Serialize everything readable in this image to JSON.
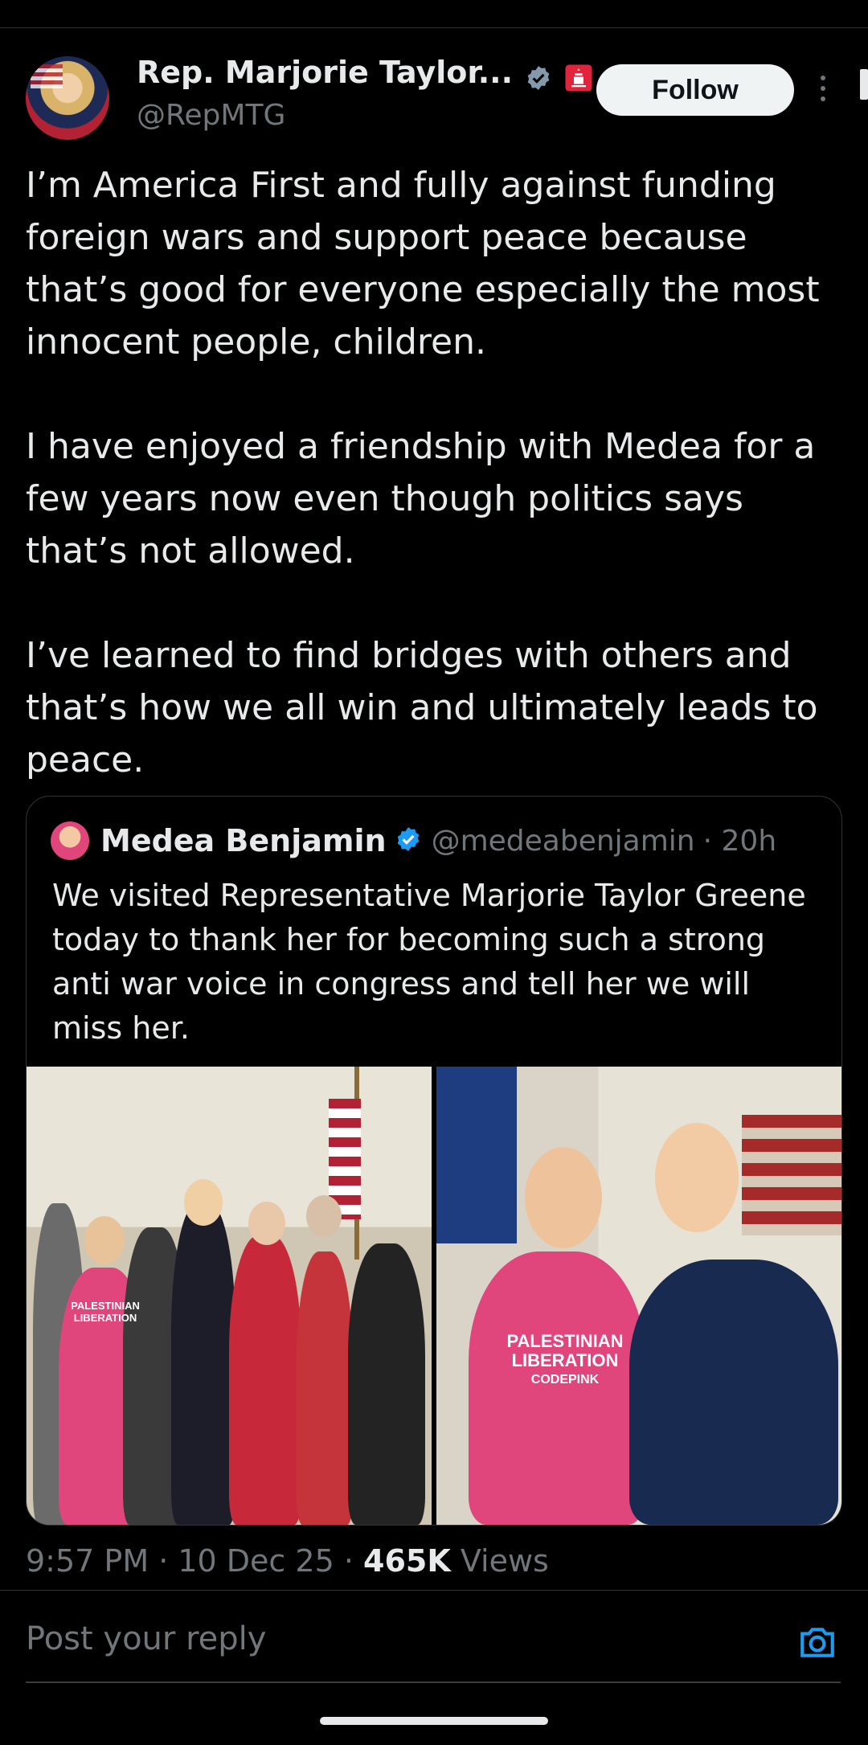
{
  "author": {
    "display_name": "Rep. Marjorie Taylor...",
    "handle": "@RepMTG",
    "follow_label": "Follow"
  },
  "tweet": {
    "paragraphs": [
      "I’m America First and fully against funding foreign wars and support peace because that’s good for everyone especially the most innocent people, children.",
      "I have enjoyed a friendship with Medea for a few years now even though politics says that’s not allowed.",
      "I’ve learned to find bridges with others and that’s how we all win and ultimately leads to peace."
    ]
  },
  "quote": {
    "display_name": "Medea Benjamin",
    "handle": "@medeabenjamin",
    "time": "· 20h",
    "text": "We visited Representative Marjorie Taylor Greene today to thank her for becoming such a strong anti war voice in congress and tell her we will miss her.",
    "shirt_line1": "PALESTINIAN",
    "shirt_line2": "LIBERATION",
    "shirt_line3": "CODEPINK"
  },
  "meta": {
    "time": "9:57 PM · 10 Dec 25 · ",
    "views_count": "465K",
    "views_label": " Views"
  },
  "reply": {
    "placeholder": "Post your reply"
  },
  "colors": {
    "background": "#000000",
    "verified": "#1d9bf0",
    "muted": "#71767b",
    "accent_pink": "#e0457b"
  },
  "icons": [
    "verified-badge-icon",
    "congress-badge-icon",
    "more-icon",
    "camera-icon"
  ]
}
